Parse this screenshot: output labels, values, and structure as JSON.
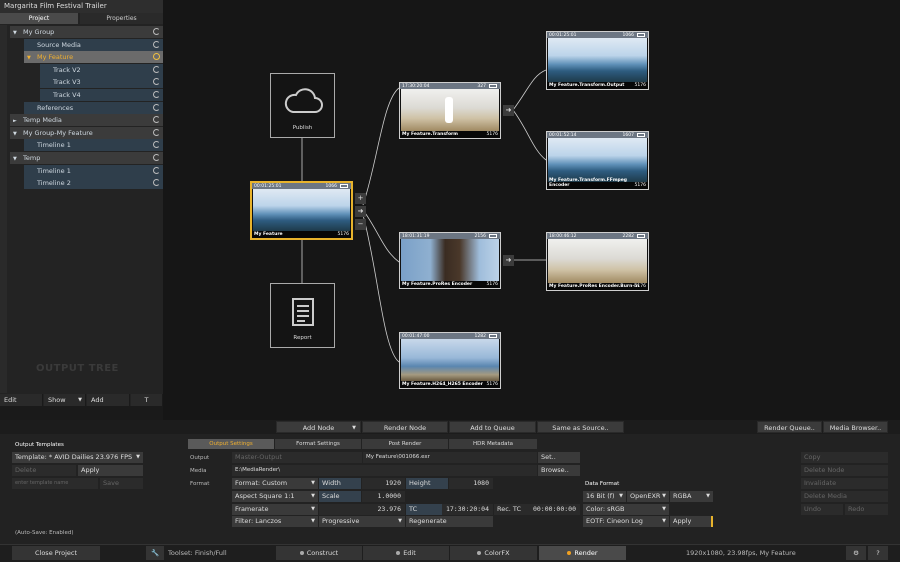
{
  "app": {
    "title": "Margarita Film Festival Trailer"
  },
  "left_tabs": [
    "Project",
    "Properties"
  ],
  "tree": [
    {
      "label": "My Group",
      "kind": "group",
      "tri": "▼"
    },
    {
      "label": "Source Media",
      "kind": "item",
      "tri": ""
    },
    {
      "label": "My Feature",
      "kind": "selected",
      "tri": "▼"
    },
    {
      "label": "Track V2",
      "kind": "item",
      "tri": ""
    },
    {
      "label": "Track V3",
      "kind": "item",
      "tri": ""
    },
    {
      "label": "Track V4",
      "kind": "item",
      "tri": ""
    },
    {
      "label": "References",
      "kind": "item",
      "tri": ""
    },
    {
      "label": "Temp Media",
      "kind": "group",
      "tri": "►"
    },
    {
      "label": "My Group-My Feature",
      "kind": "group",
      "tri": "▼"
    },
    {
      "label": "Timeline 1",
      "kind": "item",
      "tri": ""
    },
    {
      "label": "Temp",
      "kind": "group",
      "tri": "▼"
    },
    {
      "label": "Timeline 1",
      "kind": "item",
      "tri": ""
    },
    {
      "label": "Timeline 2",
      "kind": "item",
      "tri": ""
    }
  ],
  "watermark": "OUTPUT TREE",
  "left_buttons": {
    "edit": "Edit",
    "show": "Show",
    "add": "Add",
    "t": "T"
  },
  "nodes": {
    "publish": "Publish",
    "report": "Report",
    "source": {
      "tc": "00:01:25:01",
      "frame": "1066",
      "name": "My Feature",
      "count": "5176"
    },
    "transform": {
      "tc": "17:30:20:04",
      "frame": "327",
      "name": "My Feature.Transform",
      "count": "5176"
    },
    "prores": {
      "tc": "18:01:31:19",
      "frame": "2156",
      "name": "My Feature.ProRes Encoder",
      "count": "5176"
    },
    "h264": {
      "tc": "00:01:47:00",
      "frame": "1282",
      "name": "My Feature.H264_H265 Encoder",
      "count": "5176"
    },
    "t_output": {
      "tc": "00:01:25:01",
      "frame": "1066",
      "name": "My Feature.Transform.Output",
      "count": "5176"
    },
    "t_ffmpeg": {
      "tc": "00:01:52:14",
      "frame": "1607",
      "name": "My Feature.Transform.FFmpeg Encoder",
      "count": "5176"
    },
    "p_burnin": {
      "tc": "18:00:46:12",
      "frame": "2282",
      "name": "My Feature.ProRes Encoder.Burn-in",
      "count": "5176"
    }
  },
  "toolbar": {
    "add_node": "Add Node",
    "render_node": "Render Node",
    "add_to_queue": "Add to Queue",
    "same_as_source": "Same as Source..",
    "render_queue": "Render Queue..",
    "media_browser": "Media Browser.."
  },
  "templates": {
    "heading": "Output Templates",
    "template": "Template: * AVID Dailies 23.976 FPS",
    "delete": "Delete",
    "apply": "Apply",
    "name_placeholder": "enter template name",
    "save": "Save",
    "autosave": "(Auto-Save: Enabled)"
  },
  "output_tabs": [
    "Output Settings",
    "Format Settings",
    "Post Render",
    "HDR Metadata"
  ],
  "output": {
    "label_output": "Output",
    "output_path": "Master-Output",
    "output_file": "My Feature\\001066.exr",
    "set": "Set..",
    "label_media": "Media",
    "media_path": "E:\\MediaRender\\",
    "browse": "Browse..",
    "label_format": "Format",
    "format": "Format: Custom",
    "width_label": "Width",
    "width": "1920",
    "height_label": "Height",
    "height": "1080",
    "aspect": "Aspect Square 1:1",
    "scale_label": "Scale",
    "scale": "1.0000",
    "framerate": "Framerate",
    "fps": "23.976",
    "tc_label": "TC",
    "tc": "17:30:20:04",
    "rec_tc_label": "Rec. TC",
    "rec_tc": "00:00:00:00",
    "filter": "Filter: Lanczos",
    "progressive": "Progressive",
    "regenerate": "Regenerate"
  },
  "data_format": {
    "heading": "Data Format",
    "bit": "16 Bit (f)",
    "codec": "OpenEXR",
    "channels": "RGBA",
    "color": "Color: sRGB",
    "eotf": "EOTF: Cineon Log",
    "apply": "Apply"
  },
  "right_actions": [
    "Copy",
    "Delete Node",
    "Invalidate",
    "Delete Media",
    "Undo",
    "Redo"
  ],
  "bottom": {
    "close_project": "Close Project",
    "toolset": "Toolset: Finish/Full",
    "tabs": [
      "Construct",
      "Edit",
      "ColorFX",
      "Render"
    ],
    "status": "1920x1080, 23.98fps, My Feature",
    "help": "?"
  },
  "colors": {
    "accent": "#e8b32c",
    "active_tab_text": "#f0b030"
  }
}
